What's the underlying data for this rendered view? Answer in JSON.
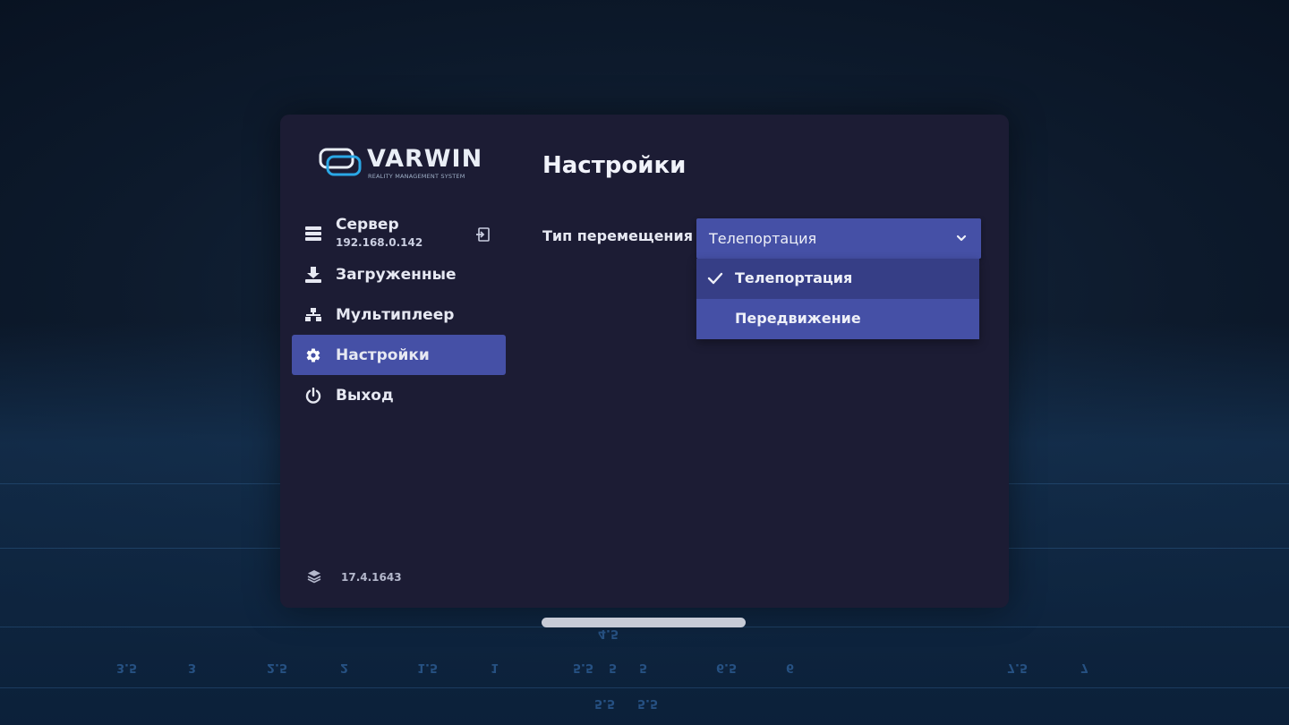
{
  "brand": {
    "name": "VARWIN",
    "tagline": "REALITY MANAGEMENT SYSTEM",
    "accent": "#2aa8e6"
  },
  "sidebar": {
    "server": {
      "label": "Сервер",
      "ip": "192.168.0.142",
      "icon": "server-icon",
      "action_icon": "login-icon"
    },
    "items": [
      {
        "label": "Загруженные",
        "icon": "download-icon",
        "active": false
      },
      {
        "label": "Мультиплеер",
        "icon": "multiplayer-icon",
        "active": false
      },
      {
        "label": "Настройки",
        "icon": "gear-icon",
        "active": true
      },
      {
        "label": "Выход",
        "icon": "power-icon",
        "active": false
      }
    ],
    "version": "17.4.1643",
    "version_icon": "layers-icon"
  },
  "main": {
    "title": "Настройки",
    "settings": [
      {
        "label": "Тип перемещения",
        "value": "Телепортация",
        "options": [
          {
            "label": "Телепортация",
            "selected": true
          },
          {
            "label": "Передвижение",
            "selected": false
          }
        ]
      }
    ]
  },
  "background": {
    "floor_labels": [
      "4.5",
      "5",
      "5",
      "5.5",
      "6",
      "6.5",
      "7",
      "7.5",
      "3.5",
      "3",
      "2.5",
      "2",
      "1.5",
      "1",
      "5.5",
      "5.5"
    ]
  },
  "colors": {
    "panel": "#1c1c34",
    "accent": "#4550a6",
    "selected_option": "#363e86"
  }
}
